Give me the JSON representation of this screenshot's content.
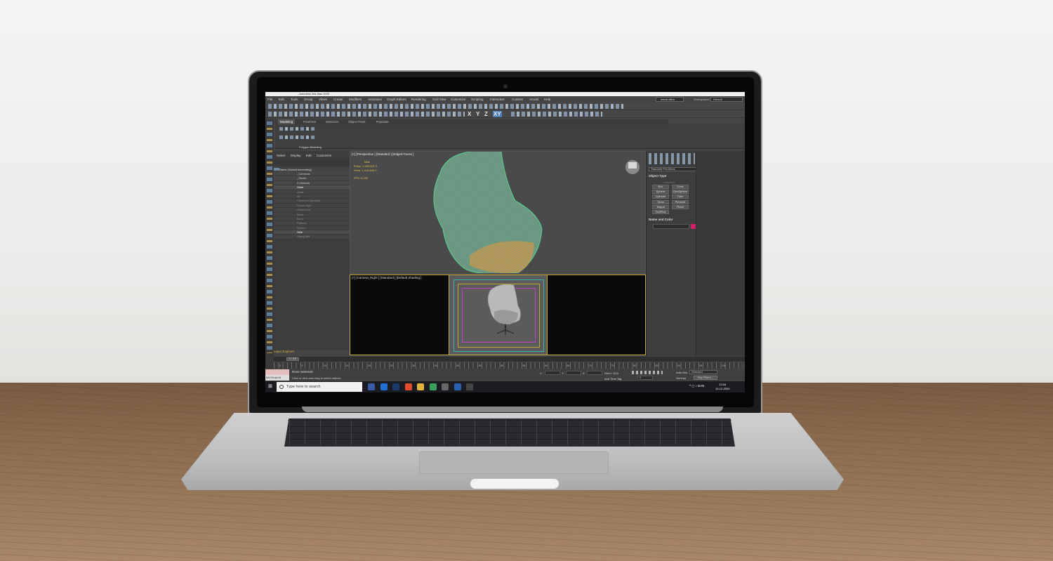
{
  "app": {
    "title": "- Autodesk 3ds Max 2020"
  },
  "menu": [
    "File",
    "Edit",
    "Tools",
    "Group",
    "Views",
    "Create",
    "Modifiers",
    "Animation",
    "Graph Editors",
    "Rendering",
    "Civil View",
    "Customize",
    "Scripting",
    "Interactive",
    "Content",
    "Arnold",
    "Help"
  ],
  "user": "ismail.dilha",
  "workspaces": {
    "label": "Workspaces:",
    "value": "Default"
  },
  "toolbar": {
    "view_dropdown": "View",
    "axis_x": "X",
    "axis_y": "Y",
    "axis_z": "Z",
    "axis_xy": "XY"
  },
  "ribbon": {
    "tabs": [
      "Modeling",
      "Freeform",
      "Selection",
      "Object Paint",
      "Populate"
    ],
    "active_tab": "Modeling",
    "group_label": "Polygon Modeling"
  },
  "explorer": {
    "tabs": [
      "Select",
      "Display",
      "Edit",
      "Customize"
    ],
    "header": "Name (Sorted Ascending)",
    "rows": [
      {
        "label": "_Cameras",
        "style": "normal"
      },
      {
        "label": "_Studio",
        "style": "normal"
      },
      {
        "label": "0 (default)",
        "style": "normal"
      },
      {
        "label": "Stole",
        "style": "bright"
      },
      {
        "label": "Adria",
        "style": "dim"
      },
      {
        "label": "Ali",
        "style": "dim"
      },
      {
        "label": "Clement Chadwick",
        "style": "dim"
      },
      {
        "label": "Ghost High",
        "style": "dim"
      },
      {
        "label": "Ghost Low",
        "style": "dim"
      },
      {
        "label": "Muse",
        "style": "dim"
      },
      {
        "label": "Nora",
        "style": "dim"
      },
      {
        "label": "Padova",
        "style": "dim"
      },
      {
        "label": "Queen",
        "style": "dim"
      },
      {
        "label": "Side",
        "style": "bright"
      },
      {
        "label": "Viking Mid",
        "style": "dim"
      }
    ],
    "footer": "Layer Explorer"
  },
  "viewport_persp": {
    "label": "[+] [Perspective ] [Standard ] [Edged Faces ]",
    "stats": {
      "total_label": "Total",
      "polys_label": "Polys:",
      "polys": "1.983.337",
      "polys_sel": "0",
      "verts_label": "Verts:",
      "verts": "1.016.628",
      "verts_sel": "0",
      "fps_label": "FPS:",
      "fps": "0,030"
    }
  },
  "viewport_cam": {
    "label": "[+] [Camera_Right ] [Standard ] [Default Shading ]"
  },
  "command_panel": {
    "dropdown": "Standard Primitives",
    "object_type": "Object Type",
    "autogrid": "AutoGrid",
    "buttons": [
      "Box",
      "Cone",
      "Sphere",
      "GeoSphere",
      "Cylinder",
      "Tube",
      "Torus",
      "Pyramid",
      "Teapot",
      "Plane",
      "TextPlus"
    ],
    "name_color": "Name and Color"
  },
  "timeline": {
    "frame": "0 / 100",
    "ticks": [
      "0",
      "5",
      "10",
      "15",
      "20",
      "25",
      "30",
      "35",
      "40",
      "45",
      "50",
      "55",
      "60",
      "65",
      "70",
      "75",
      "80",
      "85",
      "90",
      "95",
      "100"
    ]
  },
  "status": {
    "maxscript": "MAXScript Mi",
    "selection": "None Selected",
    "hint": "Click or click-and-drag to select objects",
    "x_label": "X:",
    "y_label": "Y:",
    "z_label": "Z:",
    "grid": "Grid = 10,0",
    "add_time_tag": "Add Time Tag",
    "auto_key": "Auto Key",
    "set_key": "Set Key",
    "selected": "Selected",
    "key_filters": "Key Filters...",
    "frame_field": "0"
  },
  "taskbar": {
    "search_placeholder": "Type here to search",
    "lang": "DAN",
    "time": "13:34",
    "date": "10-12-2020",
    "app_colors": [
      "#3a5ba8",
      "#1f6fd1",
      "#1b3a6b",
      "#e34b2c",
      "#e2b33c",
      "#3aa05a",
      "#666666",
      "#2b5fb0",
      "#444444"
    ]
  }
}
